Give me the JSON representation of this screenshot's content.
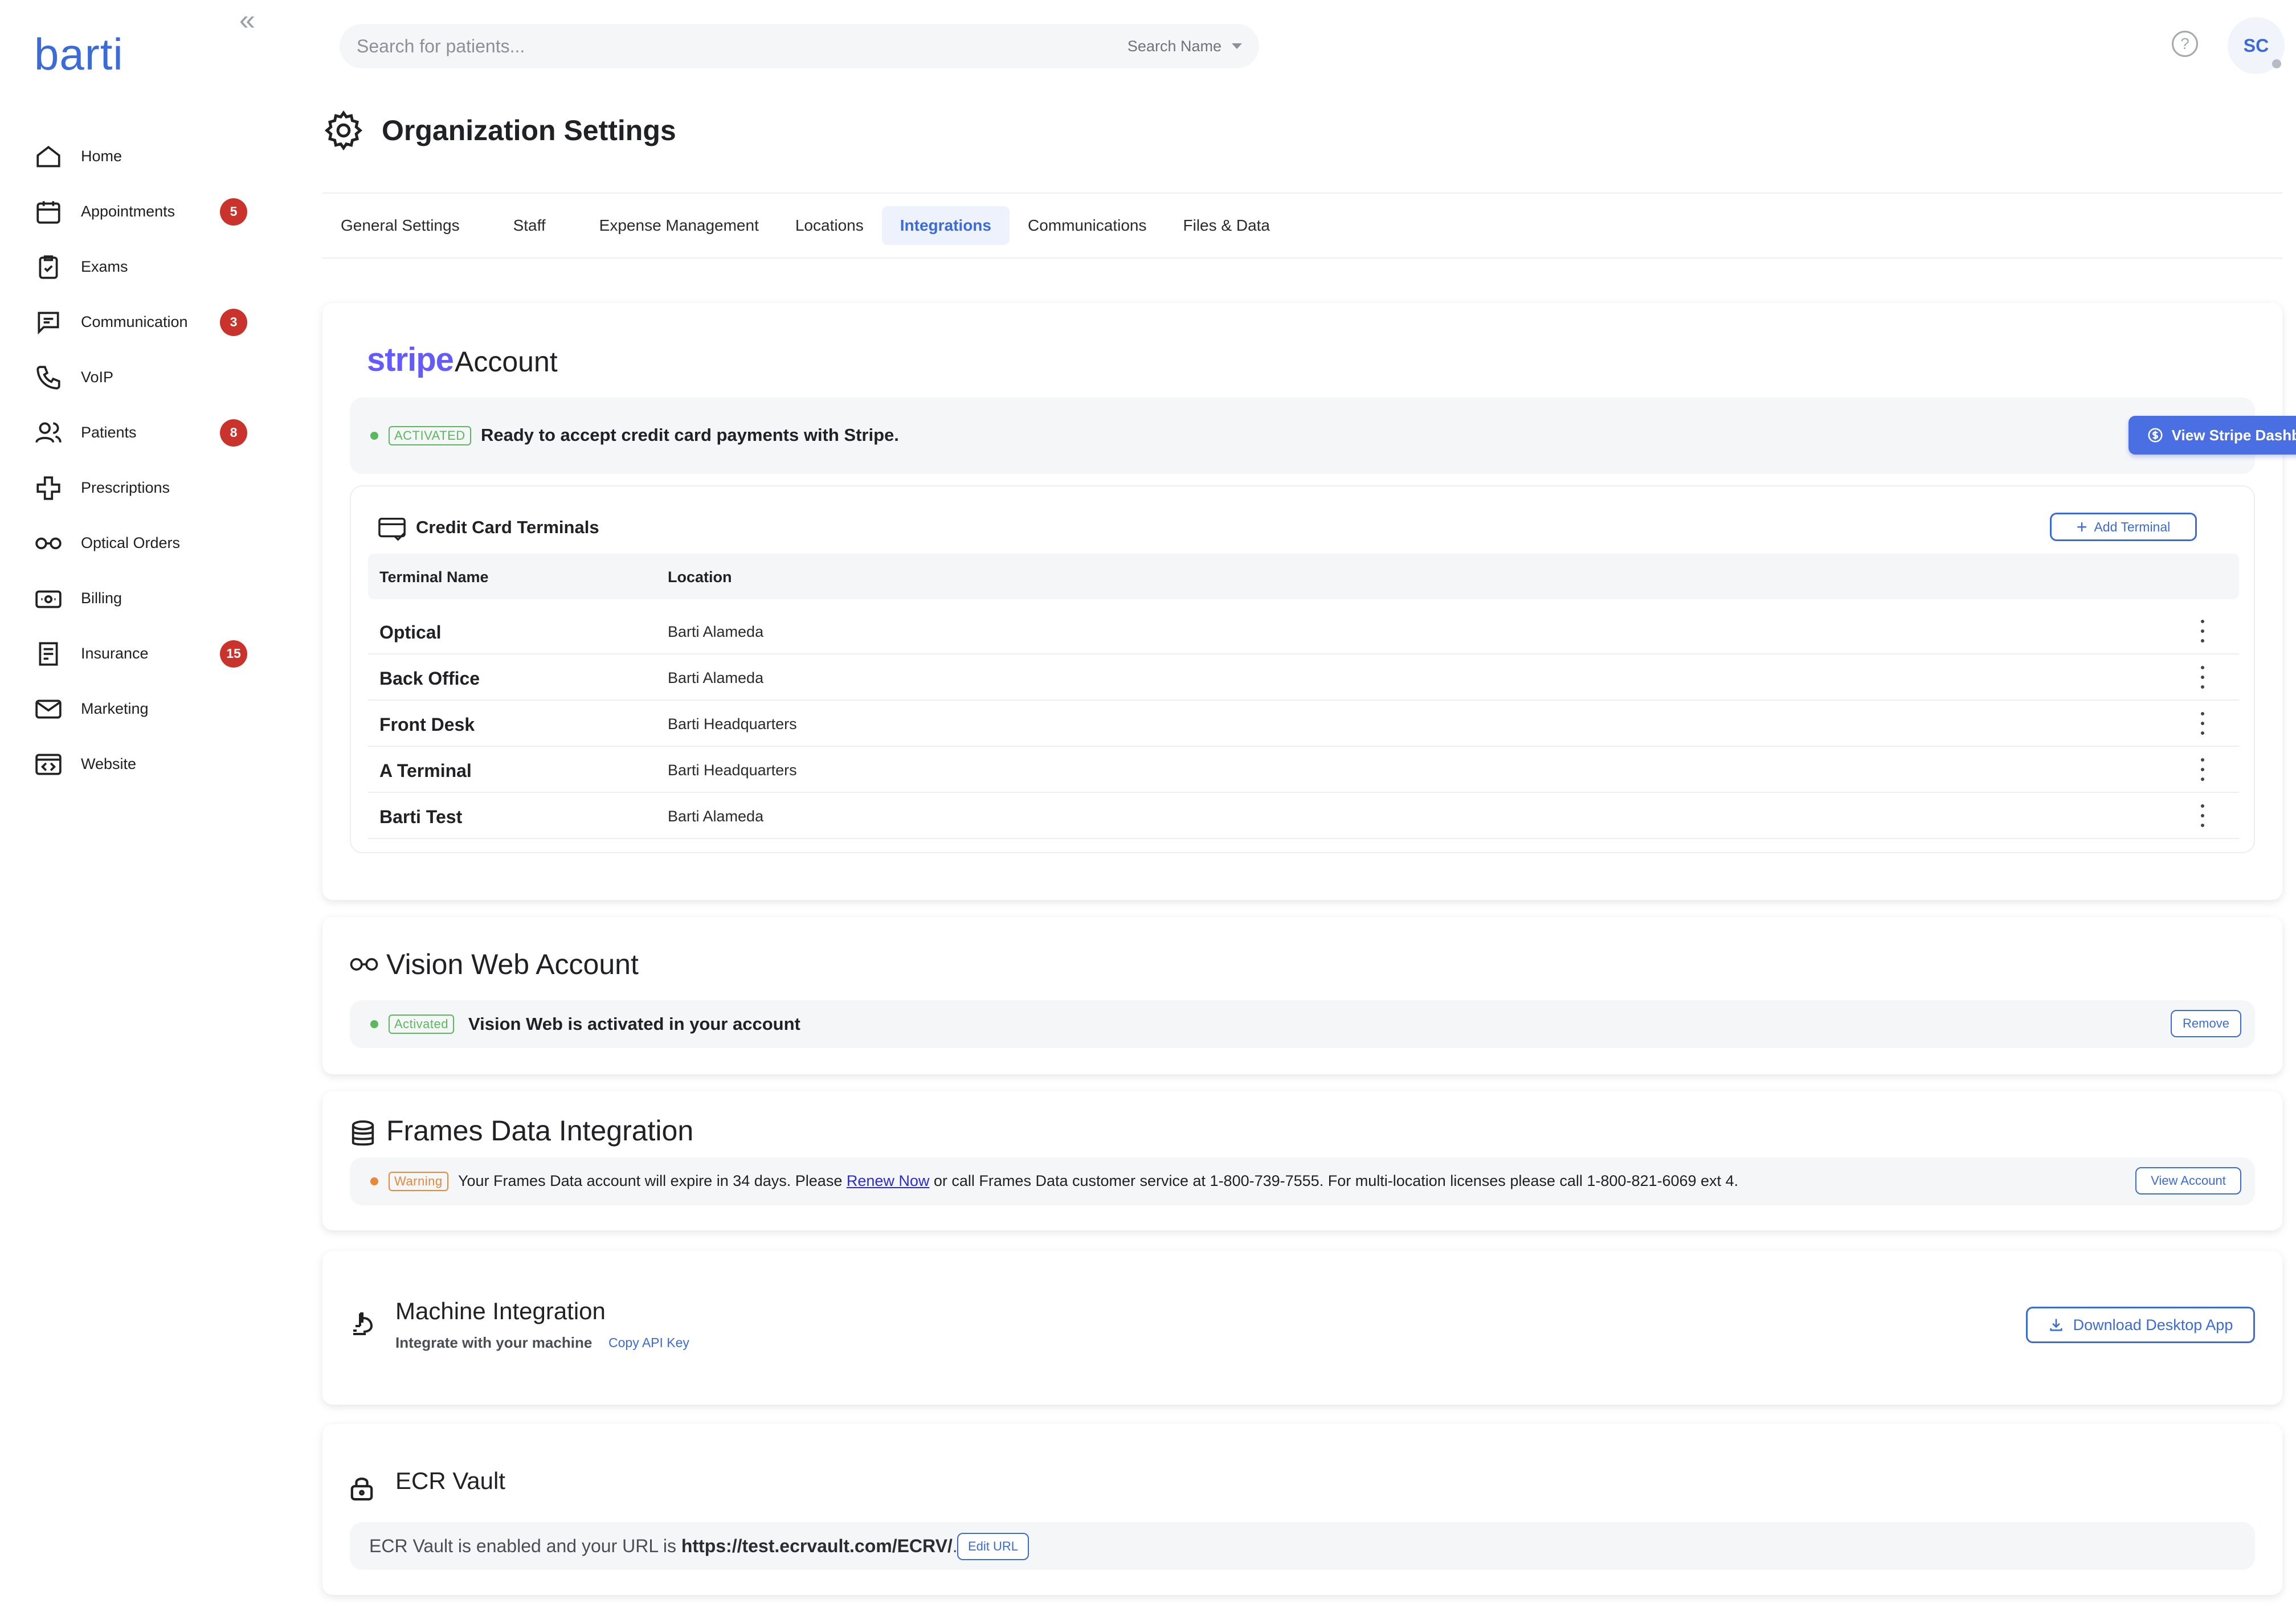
{
  "app": {
    "logo_text": "barti"
  },
  "sidebar": {
    "collapse_icon": "double-chevron-left-icon",
    "items": [
      {
        "label": "Home",
        "icon": "home-icon",
        "badge": ""
      },
      {
        "label": "Appointments",
        "icon": "calendar-icon",
        "badge": "5"
      },
      {
        "label": "Exams",
        "icon": "clipboard-icon",
        "badge": ""
      },
      {
        "label": "Communication",
        "icon": "chat-icon",
        "badge": "3"
      },
      {
        "label": "VoIP",
        "icon": "phone-icon",
        "badge": ""
      },
      {
        "label": "Patients",
        "icon": "users-icon",
        "badge": "8"
      },
      {
        "label": "Prescriptions",
        "icon": "cross-icon",
        "badge": ""
      },
      {
        "label": "Optical Orders",
        "icon": "glasses-icon",
        "badge": ""
      },
      {
        "label": "Billing",
        "icon": "cash-icon",
        "badge": ""
      },
      {
        "label": "Insurance",
        "icon": "document-icon",
        "badge": "15"
      },
      {
        "label": "Marketing",
        "icon": "mail-icon",
        "badge": ""
      },
      {
        "label": "Website",
        "icon": "code-window-icon",
        "badge": ""
      }
    ]
  },
  "topbar": {
    "search_placeholder": "Search for patients...",
    "search_mode": "Search Name",
    "help": "?",
    "avatar_initials": "SC"
  },
  "page": {
    "title": "Organization Settings",
    "tabs": [
      {
        "label": "General Settings",
        "active": false
      },
      {
        "label": "Staff",
        "active": false
      },
      {
        "label": "Expense Management",
        "active": false
      },
      {
        "label": "Locations",
        "active": false
      },
      {
        "label": "Integrations",
        "active": true
      },
      {
        "label": "Communications",
        "active": false
      },
      {
        "label": "Files & Data",
        "active": false
      }
    ]
  },
  "stripe": {
    "logo": "stripe",
    "title": "Account",
    "status": "ACTIVATED",
    "message": "Ready to accept credit card payments with Stripe.",
    "dashboard_button": "View Stripe Dashboard",
    "terminals": {
      "title": "Credit Card Terminals",
      "add_button": "Add Terminal",
      "columns": [
        "Terminal Name",
        "Location"
      ],
      "rows": [
        {
          "name": "Optical",
          "location": "Barti Alameda"
        },
        {
          "name": "Back Office",
          "location": "Barti Alameda"
        },
        {
          "name": "Front Desk",
          "location": "Barti Headquarters"
        },
        {
          "name": "A Terminal",
          "location": "Barti Headquarters"
        },
        {
          "name": "Barti Test",
          "location": "Barti Alameda"
        }
      ]
    }
  },
  "vision_web": {
    "title": "Vision Web Account",
    "status": "Activated",
    "message": "Vision Web is activated in your account",
    "remove_button": "Remove"
  },
  "frames": {
    "title": "Frames Data Integration",
    "status": "Warning",
    "message_before": "Your Frames Data account will expire in 34 days. Please ",
    "link": "Renew Now",
    "message_after": " or call Frames Data customer service at 1-800-739-7555. For multi-location licenses please call 1-800-821-6069 ext 4.",
    "view_button": "View Account"
  },
  "machine": {
    "title": "Machine Integration",
    "subtitle": "Integrate with your machine",
    "copy_link": "Copy API Key",
    "download_button": "Download Desktop App"
  },
  "ecr": {
    "title": "ECR Vault",
    "message_before": "ECR Vault is enabled and your URL is ",
    "url": "https://test.ecrvault.com/ECRV/",
    "message_after": ".",
    "edit_button": "Edit URL"
  },
  "colors": {
    "accent": "#3b6bd8",
    "badge": "#c9332b",
    "success": "#5cb85c",
    "warning": "#e8883a"
  }
}
